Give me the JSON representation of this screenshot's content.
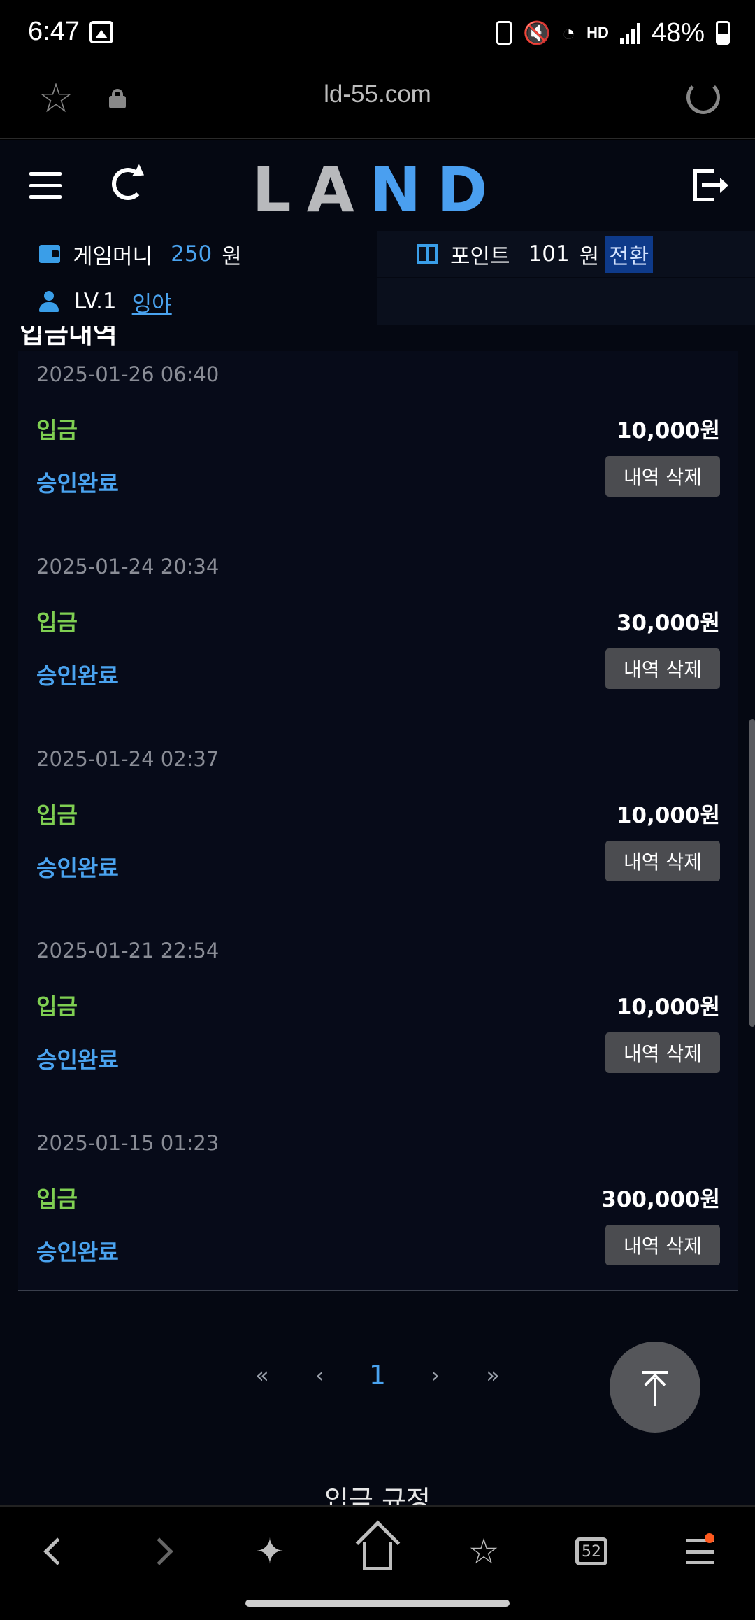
{
  "status_bar": {
    "time": "6:47",
    "battery_pct": "48%",
    "hd_label": "HD",
    "hd_sub": "voice"
  },
  "browser": {
    "url": "ld-55.com"
  },
  "site": {
    "logo": "LAND",
    "game_money_label": "게임머니",
    "game_money_value": "250",
    "game_money_unit": "원",
    "points_label": "포인트",
    "points_value": "101",
    "points_unit": "원",
    "convert_label": "전환",
    "level": "LV.1",
    "nickname": "잉야"
  },
  "section": {
    "title": "입금내역"
  },
  "transactions": [
    {
      "date": "2025-01-26 06:40",
      "type": "입금",
      "amount": "10,000원",
      "status": "승인완료",
      "delete_label": "내역 삭제"
    },
    {
      "date": "2025-01-24 20:34",
      "type": "입금",
      "amount": "30,000원",
      "status": "승인완료",
      "delete_label": "내역 삭제"
    },
    {
      "date": "2025-01-24 02:37",
      "type": "입금",
      "amount": "10,000원",
      "status": "승인완료",
      "delete_label": "내역 삭제"
    },
    {
      "date": "2025-01-21 22:54",
      "type": "입금",
      "amount": "10,000원",
      "status": "승인완료",
      "delete_label": "내역 삭제"
    },
    {
      "date": "2025-01-15 01:23",
      "type": "입금",
      "amount": "300,000원",
      "status": "승인완료",
      "delete_label": "내역 삭제"
    }
  ],
  "pagination": {
    "first": "«",
    "prev": "‹",
    "current": "1",
    "next": "›",
    "last": "»"
  },
  "footer_section": {
    "title": "입금 규정"
  },
  "bottom_nav": {
    "tab_count": "52"
  },
  "colors": {
    "accent_blue": "#4aa3ef",
    "deposit_green": "#7fcf52",
    "page_bg": "#050812"
  }
}
